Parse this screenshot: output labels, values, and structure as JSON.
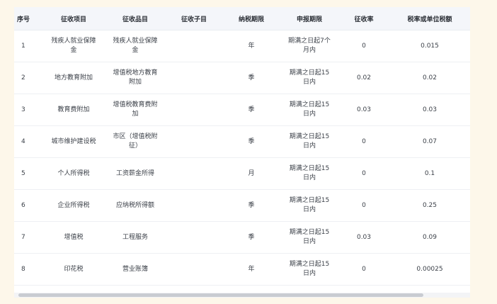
{
  "table": {
    "headers": [
      "序号",
      "征收项目",
      "征收品目",
      "征收子目",
      "纳税期限",
      "申报期限",
      "征收率",
      "税率或单位税额"
    ],
    "rows": [
      [
        "1",
        "残疾人就业保障金",
        "残疾人就业保障金",
        "",
        "年",
        "期满之日起7个月内",
        "0",
        "0.015"
      ],
      [
        "2",
        "地方教育附加",
        "增值税地方教育附加",
        "",
        "季",
        "期满之日起15日内",
        "0.02",
        "0.02"
      ],
      [
        "3",
        "教育费附加",
        "增值税教育费附加",
        "",
        "季",
        "期满之日起15日内",
        "0.03",
        "0.03"
      ],
      [
        "4",
        "城市维护建设税",
        "市区（增值税附征）",
        "",
        "季",
        "期满之日起15日内",
        "0",
        "0.07"
      ],
      [
        "5",
        "个人所得税",
        "工资薪金所得",
        "",
        "月",
        "期满之日起15日内",
        "0",
        "0.1"
      ],
      [
        "6",
        "企业所得税",
        "应纳税所得额",
        "",
        "季",
        "期满之日起15日内",
        "0",
        "0.25"
      ],
      [
        "7",
        "增值税",
        "工程服务",
        "",
        "季",
        "期满之日起15日内",
        "0.03",
        "0.09"
      ],
      [
        "8",
        "印花税",
        "营业账簿",
        "",
        "年",
        "期满之日起15日内",
        "0",
        "0.00025"
      ]
    ]
  },
  "colors": {
    "background": "#fdf7ea",
    "header_bg": "#f4f6fa",
    "text": "#3a3f47",
    "scroll_thumb": "#c9ccd2"
  }
}
